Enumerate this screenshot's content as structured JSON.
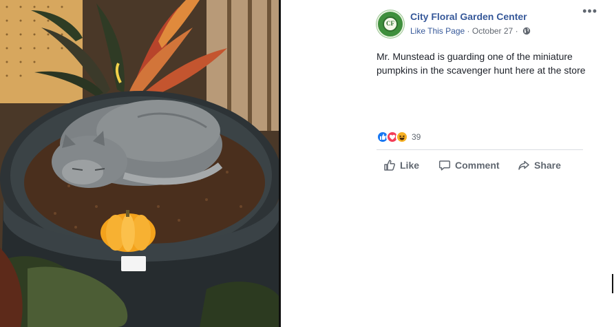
{
  "post": {
    "page_name": "City Floral Garden Center",
    "logo_text": "CF",
    "like_page": "Like This Page",
    "separator": "·",
    "date": "October 27",
    "text": "Mr. Munstead is guarding one of the miniature pumpkins in the scavenger hunt here at the store",
    "reaction_count": "39",
    "reactions": [
      "like-icon",
      "love-icon",
      "haha-icon"
    ]
  },
  "actions": {
    "like": "Like",
    "comment": "Comment",
    "share": "Share"
  },
  "colors": {
    "link": "#365899",
    "muted": "#616770",
    "like_blue": "#1877f2",
    "love_red": "#f33e58",
    "haha_yellow": "#f7b125"
  }
}
